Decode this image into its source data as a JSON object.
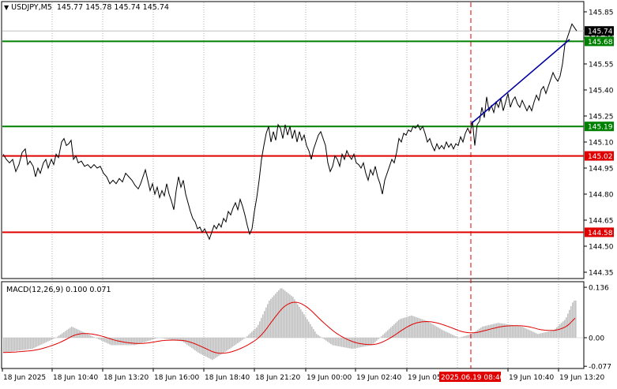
{
  "header": {
    "symbol": "USDJPY,M5",
    "ohlc": "145.77 145.78 145.74 145.74"
  },
  "price_axis": {
    "ticks": [
      "145.85",
      "145.70",
      "145.55",
      "145.40",
      "145.25",
      "145.10",
      "144.95",
      "144.80",
      "144.65",
      "144.50",
      "144.35"
    ]
  },
  "levels": [
    {
      "label": "145.74",
      "kind": "current-price",
      "color": "#000000",
      "text_color": "#ffffff"
    },
    {
      "label": "145.68",
      "kind": "resistance",
      "color": "#008000",
      "text_color": "#ffffff"
    },
    {
      "label": "145.19",
      "kind": "support-green",
      "color": "#008000",
      "text_color": "#ffffff"
    },
    {
      "label": "145.02",
      "kind": "red-level",
      "color": "#e00000",
      "text_color": "#ffffff"
    },
    {
      "label": "144.58",
      "kind": "red-level",
      "color": "#e00000",
      "text_color": "#ffffff"
    }
  ],
  "macd": {
    "title": "MACD(12,26,9) 0.100 0.071",
    "ticks": [
      "0.136",
      "0.00",
      "-0.077"
    ],
    "hist_color": "#c0c0c0",
    "signal_color": "#e00000"
  },
  "time_axis": {
    "labels": [
      "18 Jun 2025",
      "18 Jun 10:40",
      "18 Jun 13:20",
      "18 Jun 16:00",
      "18 Jun 18:40",
      "18 Jun 21:20",
      "19 Jun 00:00",
      "19 Jun 02:40",
      "19 Jun 05",
      "2025.06.19 08:40",
      "19 Jun 10:40",
      "19 Jun 13:20"
    ],
    "highlight": "2025.06.19 08:40",
    "highlight_color": "#e00000"
  },
  "colors": {
    "trendline": "#0000a0",
    "vline": "#e00000",
    "price": "#000000"
  }
}
